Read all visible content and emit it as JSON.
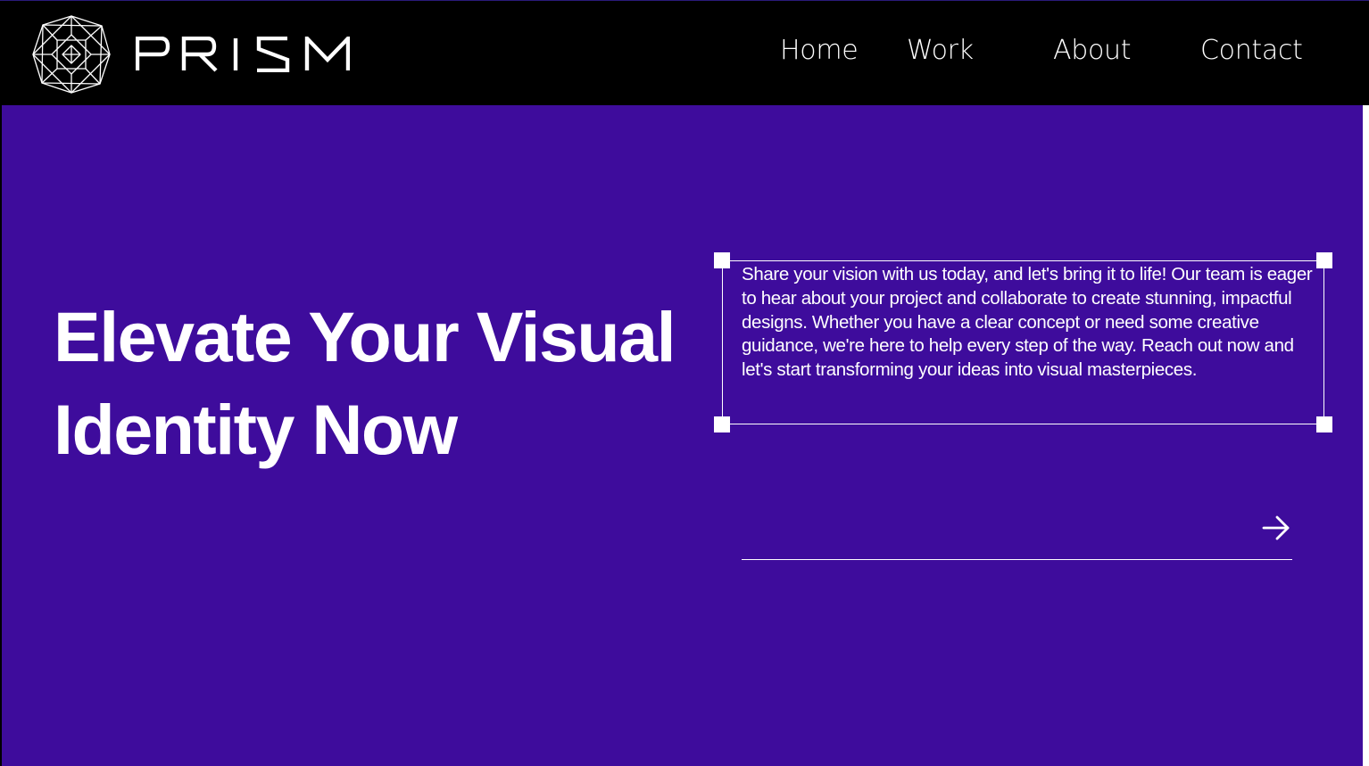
{
  "brand": {
    "name": "PRISM",
    "logo_icon": "geometric-diamond-logo-icon"
  },
  "nav": {
    "items": [
      {
        "label": "Home"
      },
      {
        "label": "Work"
      },
      {
        "label": "About"
      },
      {
        "label": "Contact"
      }
    ]
  },
  "hero": {
    "headline_line1": "Elevate Your Visual",
    "headline_line2": "Identity Now",
    "body": "Share your vision with us today, and let's bring it to life! Our team is eager to hear about your project and collaborate to create stunning, impactful designs. Whether you have a clear concept or need some creative guidance, we're here to help every step of the way. Reach out now and let's start transforming your ideas into visual masterpieces.",
    "input_value": "",
    "input_placeholder": "",
    "submit_icon": "arrow-right-icon"
  },
  "colors": {
    "header_bg": "#000000",
    "hero_bg": "#3e0c9c",
    "text": "#ffffff"
  }
}
